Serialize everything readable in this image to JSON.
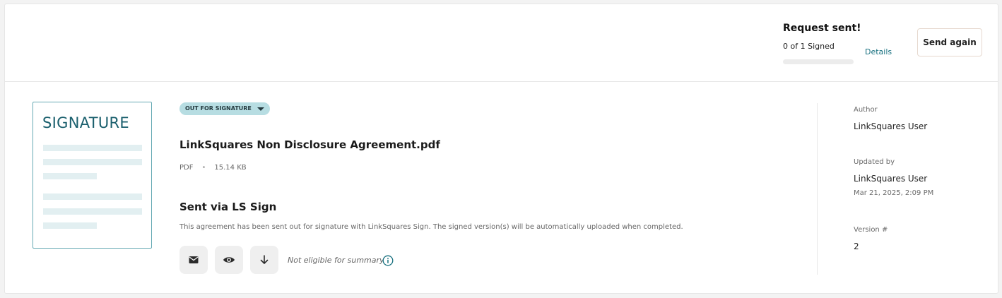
{
  "request": {
    "title": "Request sent!",
    "signed_status": "0 of 1 Signed",
    "signed_progress": 0,
    "details_link": "Details",
    "send_again_label": "Send again"
  },
  "thumbnail": {
    "title": "SIGNATURE"
  },
  "document": {
    "status_badge": "OUT FOR SIGNATURE",
    "file_name": "LinkSquares Non Disclosure Agreement.pdf",
    "file_type": "PDF",
    "file_size": "15.14 KB",
    "sent_title": "Sent via LS Sign",
    "sent_description": "This agreement has been sent out for signature with LinkSquares Sign. The signed version(s) will be automatically uploaded when completed.",
    "actions": [
      {
        "icon": "envelope-icon",
        "name": "email-button"
      },
      {
        "icon": "eye-icon",
        "name": "preview-button"
      },
      {
        "icon": "download-icon",
        "name": "download-button"
      }
    ],
    "summary_note": "Not eligible for summary"
  },
  "sidebar": {
    "author_label": "Author",
    "author_value": "LinkSquares User",
    "updated_by_label": "Updated by",
    "updated_by_value": "LinkSquares User",
    "updated_date": "Mar 21, 2025, 2:09 PM",
    "version_label": "Version #",
    "version_value": "2"
  },
  "colors": {
    "accent": "#17707f",
    "badge_bg": "#b7dde2",
    "thumbnail_border": "#67aab4",
    "button_bg": "#efefef"
  }
}
